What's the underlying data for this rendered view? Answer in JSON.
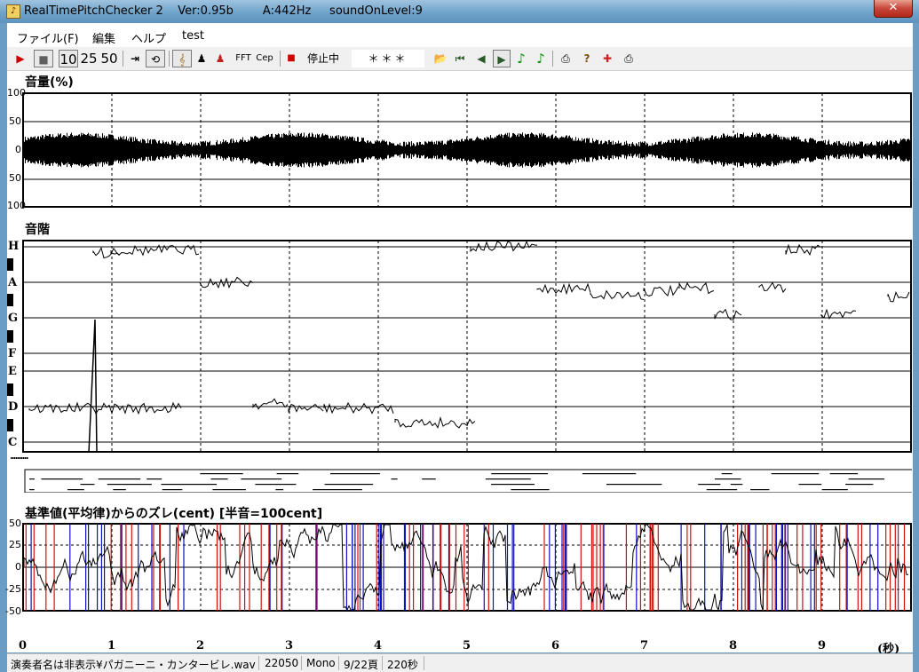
{
  "title": "RealTimePitchChecker 2    Ver:0.95b        A:442Hz     soundOnLevel:9",
  "menu": [
    "ファイル(F)",
    "編集",
    "ヘルプ",
    "test"
  ],
  "toolbar": {
    "play": "▶",
    "stop": "■",
    "speed_10": "10",
    "speed_25": "25",
    "speed_50": "50",
    "fft": "FFT",
    "cep": "Cep",
    "state": "停止中",
    "status_value": "＊＊＊"
  },
  "panels": {
    "volume": {
      "title": "音量(%)",
      "ticks": [
        "100",
        "50",
        "0",
        "50",
        "100"
      ]
    },
    "scale": {
      "title": "音階",
      "notes": [
        "H",
        "A",
        "G",
        "F",
        "E",
        "D",
        "C"
      ]
    },
    "deviation": {
      "title": "基準値(平均律)からのズレ(cent) [半音=100cent]",
      "ticks": [
        "50",
        "25",
        "0",
        "-25",
        "-50"
      ]
    }
  },
  "time_axis": {
    "ticks": [
      "0",
      "1",
      "2",
      "3",
      "4",
      "5",
      "6",
      "7",
      "8",
      "9"
    ],
    "unit": "(秒)"
  },
  "statusbar": {
    "file": "演奏者名は非表示¥パガニーニ・カンタービレ.wav",
    "rate": "22050",
    "channels": "Mono",
    "page": "9/22頁",
    "duration": "220秒"
  },
  "colors": {
    "sharp_line": "#d01010",
    "flat_line": "#1010c0",
    "trace": "#000000"
  }
}
